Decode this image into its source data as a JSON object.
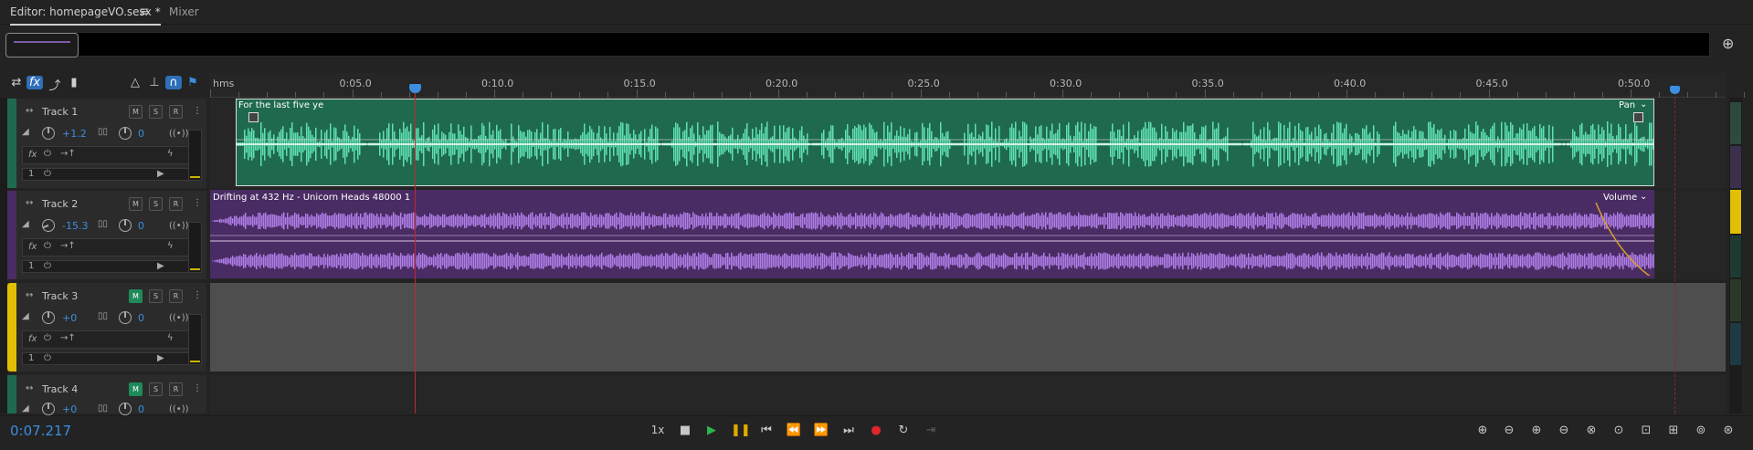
{
  "tabs": {
    "editor_label": "Editor: homepageVO.sesx *",
    "mixer_label": "Mixer",
    "menu_glyph": "≡"
  },
  "ruler": {
    "unit": "hms",
    "ticks": [
      "0:05.0",
      "0:10.0",
      "0:15.0",
      "0:20.0",
      "0:25.0",
      "0:30.0",
      "0:35.0",
      "0:40.0",
      "0:45.0",
      "0:50.0"
    ]
  },
  "tracks": [
    {
      "name": "Track 1",
      "m": "M",
      "s": "S",
      "r": "R",
      "volume": "+1.2",
      "pan": "0",
      "fx": "fx",
      "input": "1",
      "color": "#1f6a4e",
      "mute_on": false
    },
    {
      "name": "Track 2",
      "m": "M",
      "s": "S",
      "r": "R",
      "volume": "-15.3",
      "pan": "0",
      "fx": "fx",
      "input": "1",
      "color": "#4a2c64",
      "mute_on": false
    },
    {
      "name": "Track 3",
      "m": "M",
      "s": "S",
      "r": "R",
      "volume": "+0",
      "pan": "0",
      "fx": "fx",
      "input": "1",
      "color": "#e0c000",
      "mute_on": true
    },
    {
      "name": "Track 4",
      "m": "M",
      "s": "S",
      "r": "R",
      "volume": "+0",
      "pan": "0",
      "color": "#1f6a4e",
      "mute_on": true
    }
  ],
  "clips": {
    "clip1_label": "For the last five ye",
    "clip1_param": "Pan",
    "clip2_label": "Drifting at 432 Hz - Unicorn Heads 48000 1",
    "clip2_param": "Volume"
  },
  "transport": {
    "timecode": "0:07.217",
    "speed": "1x"
  },
  "colors": {
    "accent": "#3c8ee0",
    "clip_green": "#1f6a4e",
    "wave_green": "#5fe0b0",
    "clip_purple": "#4a2c64",
    "wave_purple": "#b07ee8",
    "playhead": "#c0272d"
  },
  "icons": [
    "switch-icon",
    "fx-icon",
    "send-icon",
    "meter-icon",
    "metronome-icon",
    "snap-icon",
    "stop-icon",
    "play-icon",
    "pause-icon",
    "skip-start-icon",
    "rewind-icon",
    "fast-forward-icon",
    "skip-end-icon",
    "record-icon",
    "loop-icon",
    "skip-selection-icon",
    "zoom-in-amplitude-icon",
    "zoom-out-amplitude-icon"
  ]
}
